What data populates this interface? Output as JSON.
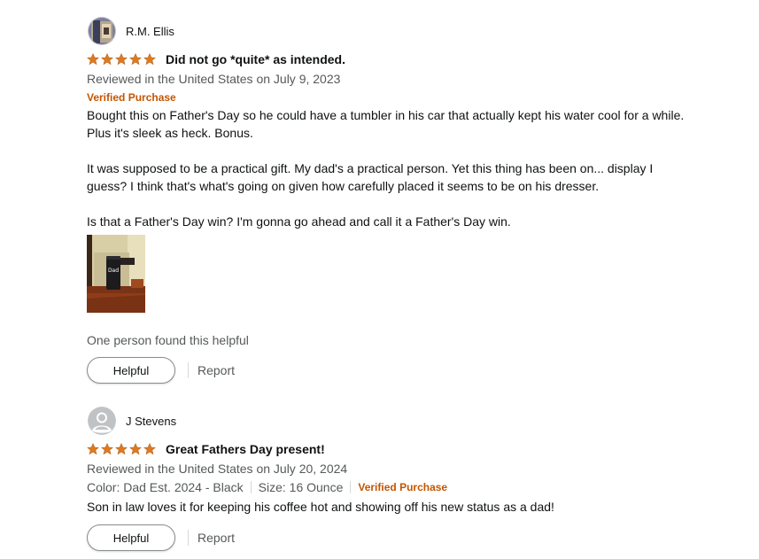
{
  "reviews": [
    {
      "author": "R.M. Ellis",
      "avatar_icon": "user-photo-avatar",
      "rating": 5,
      "title": "Did not go *quite* as intended.",
      "reviewed_in": "Reviewed in the United States on July 9, 2023",
      "verified": "Verified Purchase",
      "body": [
        "Bought this on Father's Day so he could have a tumbler in his car that actually kept his water cool for a while. Plus it's sleek as heck. Bonus.",
        "It was supposed to be a practical gift. My dad's a practical person. Yet this thing has been on... display I guess? I think that's what's going on given how carefully placed it seems to be on his dresser.",
        "Is that a Father's Day win? I'm gonna go ahead and call it a Father's Day win."
      ],
      "photo_label": "Dad",
      "helpful_count": "One person found this helpful",
      "helpful_label": "Helpful",
      "report_label": "Report"
    },
    {
      "author": "J Stevens",
      "avatar_icon": "default-user-avatar",
      "rating": 5,
      "title": "Great Fathers Day present!",
      "reviewed_in": "Reviewed in the United States on July 20, 2024",
      "color": "Color: Dad Est. 2024 - Black",
      "size": "Size: 16 Ounce",
      "verified": "Verified Purchase",
      "body": "Son in law loves it for keeping his coffee hot and showing off his new status as a dad!",
      "helpful_label": "Helpful",
      "report_label": "Report"
    }
  ],
  "colors": {
    "star": "#de7921",
    "verified": "#c45500",
    "meta": "#565959",
    "text": "#0f1111"
  }
}
